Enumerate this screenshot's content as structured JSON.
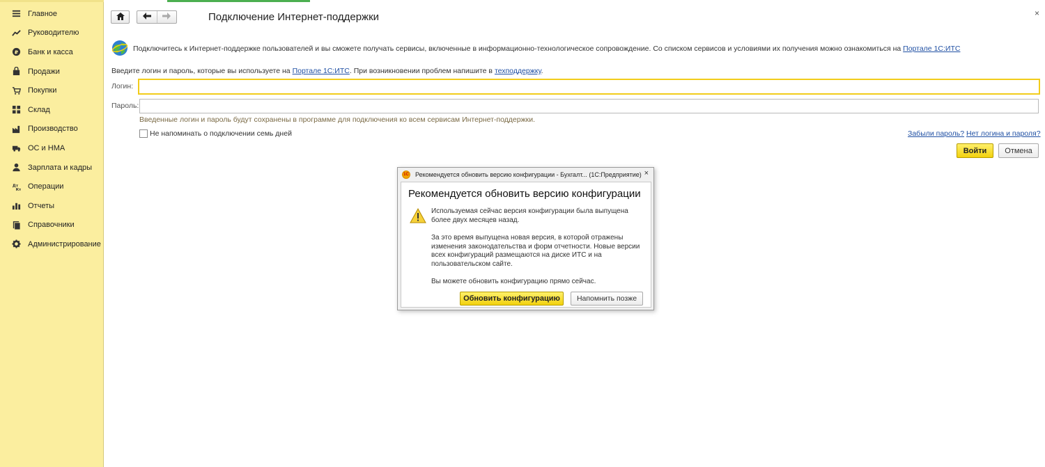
{
  "sidebar": {
    "items": [
      {
        "label": "Главное",
        "icon": "menu-icon"
      },
      {
        "label": "Руководителю",
        "icon": "trend-icon"
      },
      {
        "label": "Банк и касса",
        "icon": "coin-icon"
      },
      {
        "label": "Продажи",
        "icon": "bag-icon"
      },
      {
        "label": "Покупки",
        "icon": "cart-icon"
      },
      {
        "label": "Склад",
        "icon": "grid-icon"
      },
      {
        "label": "Производство",
        "icon": "factory-icon"
      },
      {
        "label": "ОС и НМА",
        "icon": "truck-icon"
      },
      {
        "label": "Зарплата и кадры",
        "icon": "person-icon"
      },
      {
        "label": "Операции",
        "icon": "operations-icon"
      },
      {
        "label": "Отчеты",
        "icon": "bar-chart-icon"
      },
      {
        "label": "Справочники",
        "icon": "book-icon"
      },
      {
        "label": "Администрирование",
        "icon": "gear-icon"
      }
    ]
  },
  "header": {
    "title": "Подключение Интернет-поддержки",
    "close": "×"
  },
  "intro": {
    "text": "Подключитесь к Интернет-поддержке пользователей и вы сможете получать сервисы, включенные в информационно-технологическое сопровождение. Со списком сервисов и условиями их получения можно ознакомиться на ",
    "link": "Портале 1С:ИТС"
  },
  "form": {
    "hint_prefix": "Введите логин и пароль, которые вы используете на ",
    "hint_link": "Портале 1С:ИТС",
    "hint_middle": ". При возникновении проблем напишите в ",
    "hint_support_link": "техподдержку",
    "hint_suffix": ".",
    "login_label": "Логин:",
    "login_value": "",
    "password_label": "Пароль:",
    "password_value": "",
    "saved_note": "Введенные логин и пароль будут сохранены в программе для подключения ко всем сервисам Интернет-поддержки.",
    "remind_label": "Не напоминать о подключении семь дней",
    "forgot_link": "Забыли пароль?",
    "no_login_link": "Нет логина и пароля?",
    "login_button": "Войти",
    "cancel_button": "Отмена"
  },
  "dialog": {
    "title": "Рекомендуется обновить версию конфигурации - Бухгалт...  (1С:Предприятие)",
    "app_icon_text": "1С",
    "close": "×",
    "heading": "Рекомендуется обновить версию конфигурации",
    "text1": "Используемая сейчас версия конфигурации была выпущена более двух месяцев назад.",
    "text2": "За это время выпущена новая версия, в которой отражены изменения законодательства и форм отчетности. Новые версии всех конфигураций размещаются на диске ИТС и на пользовательском сайте.",
    "text3": "Вы можете обновить конфигурацию прямо сейчас.",
    "update_button": "Обновить конфигурацию",
    "later_button": "Напомнить позже"
  },
  "colors": {
    "sidebar_bg": "#fbee9f",
    "accent_yellow": "#f2d10e",
    "link": "#1f4fa3",
    "tab_accent": "#4caf50"
  }
}
